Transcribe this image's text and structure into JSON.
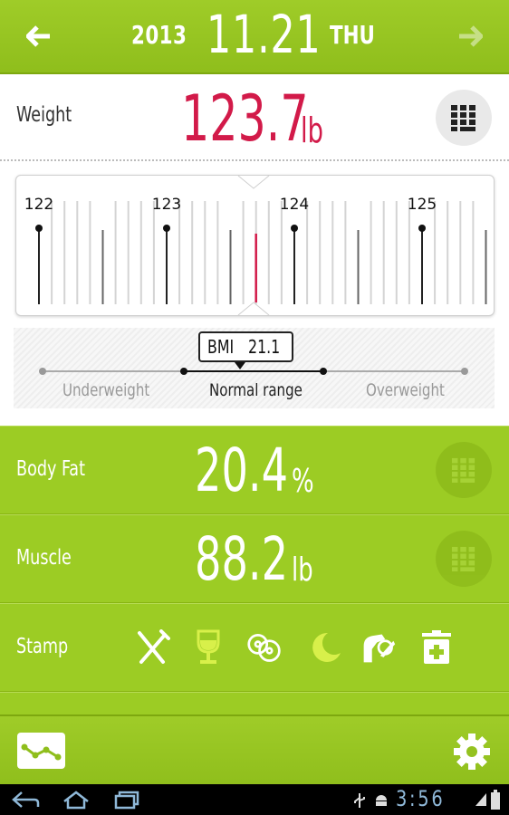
{
  "header": {
    "year": "2013",
    "date": "11.21",
    "weekday": "THU",
    "prev_icon": "arrow-left-icon",
    "next_icon": "arrow-right-icon"
  },
  "weight": {
    "label": "Weight",
    "value": "123.7",
    "unit": "lb",
    "value_color": "#d21a49",
    "keypad_icon": "keypad-icon"
  },
  "ruler": {
    "min": 122,
    "max": 125,
    "major_labels": [
      "122",
      "123",
      "124",
      "125"
    ],
    "current_value": 123.7,
    "marker_color": "#d21a49"
  },
  "bmi": {
    "badge_label": "BMI",
    "badge_value": "21.1",
    "ranges": [
      "Underweight",
      "Normal range",
      "Overweight"
    ],
    "active_range": "Normal range"
  },
  "body_fat": {
    "label": "Body Fat",
    "value": "20.4",
    "unit": "%",
    "keypad_icon": "keypad-icon"
  },
  "muscle": {
    "label": "Muscle",
    "value": "88.2",
    "unit": "lb",
    "keypad_icon": "keypad-icon"
  },
  "stamp": {
    "label": "Stamp",
    "icons": [
      {
        "name": "fork-knife-icon",
        "active": false
      },
      {
        "name": "wine-glass-icon",
        "active": true
      },
      {
        "name": "weight-plates-icon",
        "active": false
      },
      {
        "name": "moon-icon",
        "active": true
      },
      {
        "name": "exercise-icon",
        "active": false
      },
      {
        "name": "first-aid-kit-icon",
        "active": false
      }
    ]
  },
  "bottom_bar": {
    "graph_icon": "graph-icon",
    "settings_icon": "gear-icon"
  },
  "system_bar": {
    "clock": "3:56",
    "buttons": [
      "back-icon",
      "home-icon",
      "recent-apps-icon"
    ],
    "status_icons": [
      "usb-icon",
      "android-debug-icon",
      "signal-icon",
      "battery-icon"
    ]
  },
  "colors": {
    "accent_green": "#9ccc24",
    "weight_red": "#d21a49",
    "stamp_active": "#d8f04a"
  }
}
